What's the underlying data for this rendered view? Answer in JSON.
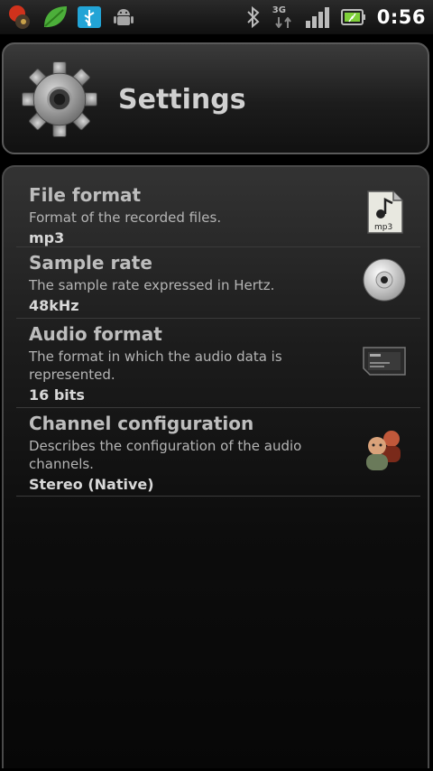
{
  "status_bar": {
    "clock": "0:56",
    "network": "3G",
    "left_icons": [
      "recorder-icon",
      "leaf-icon",
      "usb-icon",
      "android-icon"
    ],
    "right_icons": [
      "bluetooth-icon",
      "network-3g-icon",
      "signal-icon",
      "battery-icon"
    ]
  },
  "header": {
    "title": "Settings",
    "icon": "gear-icon"
  },
  "settings": [
    {
      "title": "File format",
      "description": "Format of the recorded files.",
      "value": "mp3",
      "icon": "mp3-file-icon"
    },
    {
      "title": "Sample rate",
      "description": "The sample rate expressed in Hertz.",
      "value": "48kHz",
      "icon": "disc-icon"
    },
    {
      "title": "Audio format",
      "description": "The format in which the audio data is represented.",
      "value": "16 bits",
      "icon": "memory-card-icon"
    },
    {
      "title": "Channel configuration",
      "description": "Describes the configuration of the audio channels.",
      "value": "Stereo (Native)",
      "icon": "people-icon"
    }
  ],
  "colors": {
    "accent_green": "#4caf3a",
    "usb_blue": "#22a4d6",
    "title_text": "#d0d0d0",
    "panel_border": "#5a5a5a"
  }
}
